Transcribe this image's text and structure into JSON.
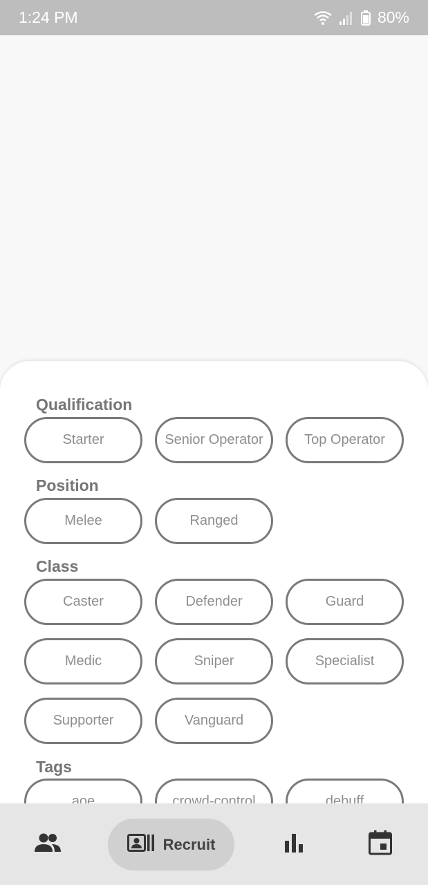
{
  "status_bar": {
    "time": "1:24 PM",
    "battery": "80%",
    "icons": [
      "wifi-icon",
      "signal-icon",
      "battery-icon"
    ]
  },
  "filters": {
    "qualification": {
      "title": "Qualification",
      "chips": [
        "Starter",
        "Senior Operator",
        "Top Operator"
      ]
    },
    "position": {
      "title": "Position",
      "chips": [
        "Melee",
        "Ranged"
      ]
    },
    "class": {
      "title": "Class",
      "chips": [
        "Caster",
        "Defender",
        "Guard",
        "Medic",
        "Sniper",
        "Specialist",
        "Supporter",
        "Vanguard"
      ]
    },
    "tags": {
      "title": "Tags",
      "chips": [
        "aoe",
        "crowd-control",
        "debuff"
      ]
    }
  },
  "bottom_nav": {
    "items": [
      {
        "icon": "people-icon",
        "label": ""
      },
      {
        "icon": "recruit-card-icon",
        "label": "Recruit",
        "active": true
      },
      {
        "icon": "bar-chart-icon",
        "label": ""
      },
      {
        "icon": "calendar-icon",
        "label": ""
      }
    ]
  },
  "colors": {
    "status_bar": "#bdbdbd",
    "chip_border": "#7a7a7a",
    "chip_text": "#8e8e8e",
    "section_title": "#757575",
    "nav_bg": "#e6e6e6",
    "nav_active_pill": "#d0d0d0",
    "nav_icon": "#333333"
  }
}
